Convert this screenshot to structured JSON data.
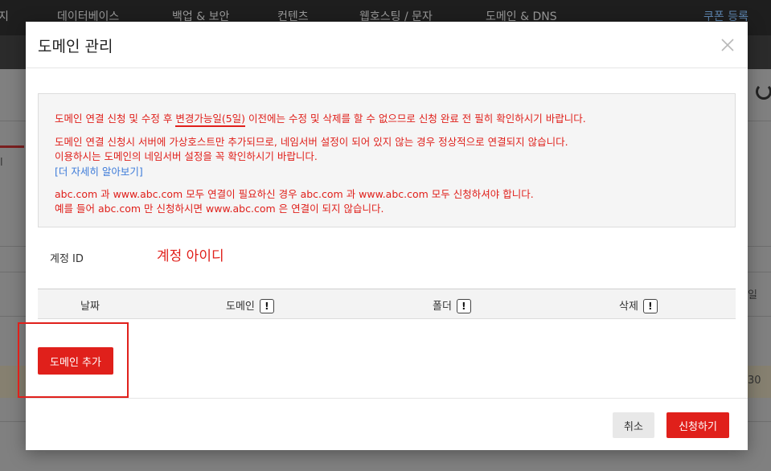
{
  "background": {
    "nav_items": [
      "지",
      "데이터베이스",
      "백업 & 보안",
      "컨텐츠",
      "웹호스팅 / 문자",
      "도메인 & DNS"
    ],
    "coupon_link": "쿠폰 등록",
    "side_text_1": "l",
    "side_text_2": "일",
    "side_text_3": "30"
  },
  "modal": {
    "title": "도메인 관리",
    "notice": {
      "line1_pre": "도메인 연결 신청 및 수정 후 ",
      "line1_em": "변경가능일(5일)",
      "line1_post": " 이전에는 수정 및 삭제를 할 수 없으므로 신청 완료 전 필히 확인하시기 바랍니다.",
      "line2": "도메인 연결 신청시 서버에 가상호스트만 추가되므로, 네임서버 설정이 되어 있지 않는 경우 정상적으로 연결되지 않습니다.",
      "line3": "이용하시는 도메인의 네임서버 설정을 꼭 확인하시기 바랍니다.",
      "learn_more": "[더 자세히 알아보기]",
      "line4": "abc.com 과 www.abc.com 모두 연결이 필요하신 경우 abc.com 과 www.abc.com 모두 신청하셔야 합니다.",
      "line5": "예를 들어 abc.com 만 신청하시면 www.abc.com 은 연결이 되지 않습니다."
    },
    "account_label": "계정 ID",
    "account_value": "계정 아이디",
    "table_headers": {
      "date": "날짜",
      "domain": "도메인",
      "folder": "폴더",
      "delete": "삭제"
    },
    "info_icon_glyph": "!",
    "add_domain_button": "도메인 추가",
    "cancel_button": "취소",
    "submit_button": "신청하기"
  }
}
